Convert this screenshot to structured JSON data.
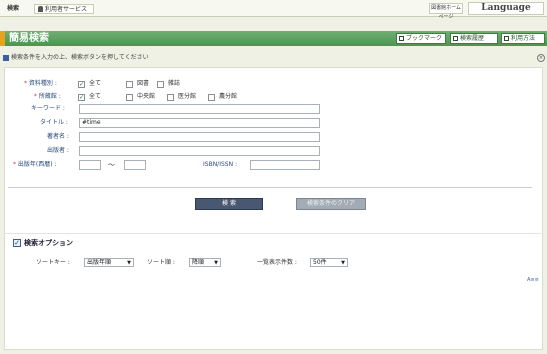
{
  "topnav": {
    "search_tab": "検索",
    "user_service_tab": "利用者サービス",
    "library_home": "図書館ホームページ",
    "language": "Language"
  },
  "titlebar": {
    "title": "簡易検索",
    "bookmark": "ブックマーク",
    "search_history": "検索履歴",
    "help": "利用方法"
  },
  "instruction": "検索条件を入力の上、検索ボタンを押してください",
  "form": {
    "material_type": {
      "label": "資料種別",
      "options": [
        "全て",
        "図書",
        "雑誌"
      ],
      "checked": [
        true,
        false,
        false
      ]
    },
    "location": {
      "label": "所蔵館",
      "options": [
        "全て",
        "中央館",
        "医分館",
        "農分館"
      ],
      "checked": [
        true,
        false,
        false,
        false
      ]
    },
    "keyword": {
      "label": "キーワード",
      "value": ""
    },
    "title": {
      "label": "タイトル",
      "value": "#time"
    },
    "author": {
      "label": "著者名",
      "value": ""
    },
    "publisher": {
      "label": "出版者",
      "value": ""
    },
    "pub_year": {
      "label": "出版年(西暦)",
      "from": "",
      "to": "",
      "separator": "～"
    },
    "isbn": {
      "label": "ISBN/ISSN",
      "value": ""
    }
  },
  "buttons": {
    "search": "検 索",
    "clear": "検索条件のクリア"
  },
  "options": {
    "title": "検索オプション",
    "sort_key_label": "ソートキー",
    "sort_key": "出版年順",
    "sort_order_label": "ソート順",
    "sort_order": "降順",
    "per_page_label": "一覧表示件数",
    "per_page": "50件"
  },
  "page_top": "A≡≡"
}
